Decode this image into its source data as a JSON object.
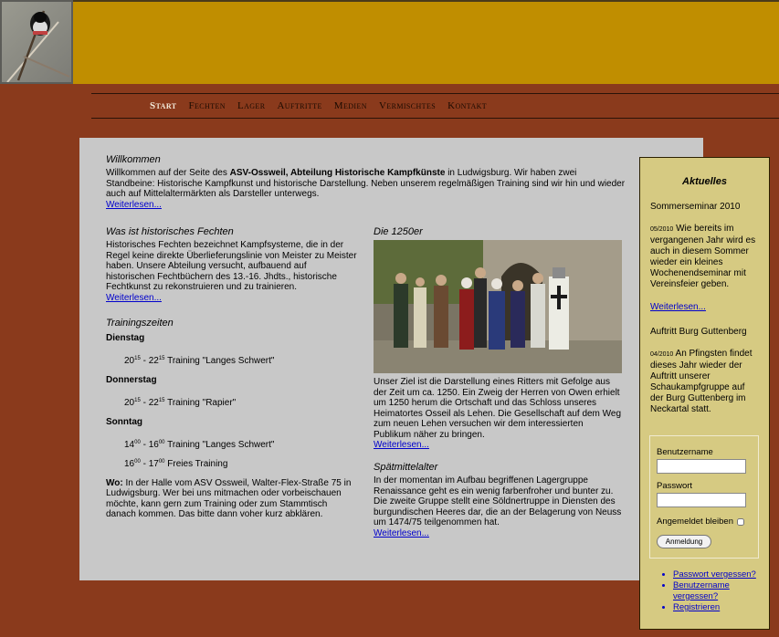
{
  "nav": [
    "Start",
    "Fechten",
    "Lager",
    "Auftritte",
    "Medien",
    "Vermischtes",
    "Kontakt"
  ],
  "welcome": {
    "title": "Willkommen",
    "text_before": "Willkommen auf der Seite des ",
    "text_bold": "ASV-Ossweil, Abteilung Historische Kampfkünste",
    "text_after": " in Ludwigsburg. Wir haben zwei Standbeine: Historische Kampfkunst und historische Darstellung. Neben unserem regelmäßigen Training sind wir hin und wieder auch auf Mittelaltermärkten als Darsteller unterwegs.",
    "more": "Weiterlesen..."
  },
  "fencing": {
    "title": "Was ist historisches Fechten",
    "text": "Historisches Fechten bezeichnet Kampfsysteme, die in der Regel keine direkte Überlieferungslinie von Meister zu Meister haben. Unsere Abteilung versucht, aufbauend auf historischen Fechtbüchern des 13.-16. Jhdts., historische Fechtkunst zu rekonstruieren und zu trainieren.",
    "more": "Weiterlesen..."
  },
  "training": {
    "title": "Trainingszeiten",
    "day1": "Dienstag",
    "slot1": {
      "start_h": "20",
      "start_m": "15",
      "sep": " - ",
      "end_h": "22",
      "end_m": "15",
      "label": " Training \"Langes Schwert\""
    },
    "day2": "Donnerstag",
    "slot2": {
      "start_h": "20",
      "start_m": "15",
      "sep": " - ",
      "end_h": "22",
      "end_m": "15",
      "label": " Training \"Rapier\""
    },
    "day3": "Sonntag",
    "slot3": {
      "start_h": "14",
      "start_m": "00",
      "sep": " - ",
      "end_h": "16",
      "end_m": "00",
      "label": " Training \"Langes Schwert\""
    },
    "slot4": {
      "start_h": "16",
      "start_m": "00",
      "sep": " - ",
      "end_h": "17",
      "end_m": "00",
      "label": " Freies Training"
    },
    "where_label": "Wo:",
    "where_text": " In der Halle vom ASV Ossweil, Walter-Flex-Straße 75 in Ludwigsburg. Wer bei uns mitmachen oder vorbeischauen möchte, kann gern zum Training oder zum Stammtisch danach kommen.  Das bitte dann voher kurz abklären."
  },
  "group1250": {
    "title": "Die 1250er",
    "text": "Unser Ziel ist die Darstellung eines Ritters mit Gefolge aus der Zeit um ca. 1250. Ein Zweig der Herren von Owen erhielt um 1250 herum die Ortschaft und das Schloss unseres Heimatortes Osseil als Lehen. Die Gesellschaft auf dem Weg zum neuen Lehen versuchen wir dem interessierten Publikum näher zu bringen.",
    "more": "Weiterlesen..."
  },
  "late": {
    "title": "Spätmittelalter",
    "text": "In der momentan im Aufbau begriffenen Lagergruppe Renaissance geht es ein wenig farbenfroher und bunter zu. Die zweite Gruppe stellt eine Söldnertruppe in Diensten des burgundischen Heeres dar, die an der Belagerung von Neuss um 1474/75 teilgenommen hat.",
    "more": "Weiterlesen..."
  },
  "sidebar": {
    "title": "Aktuelles",
    "news1_head": "Sommerseminar 2010",
    "news1_date": "05/2010",
    "news1_text": " Wie bereits im vergangenen Jahr wird es auch in diesem Sommer wieder ein kleines Wochenendseminar mit Vereinsfeier geben.",
    "news1_more": "Weiterlesen...",
    "news2_head": "Auftritt Burg Guttenberg",
    "news2_date": "04/2010",
    "news2_text": " An Pfingsten findet dieses Jahr wieder der Auftritt unserer Schaukampfgruppe auf der Burg Guttenberg im Neckartal statt.",
    "login": {
      "username": "Benutzername",
      "password": "Passwort",
      "remember": "Angemeldet bleiben",
      "button": "Anmeldung"
    },
    "links": [
      "Passwort vergessen?",
      "Benutzername vergessen?",
      "Registrieren"
    ]
  }
}
